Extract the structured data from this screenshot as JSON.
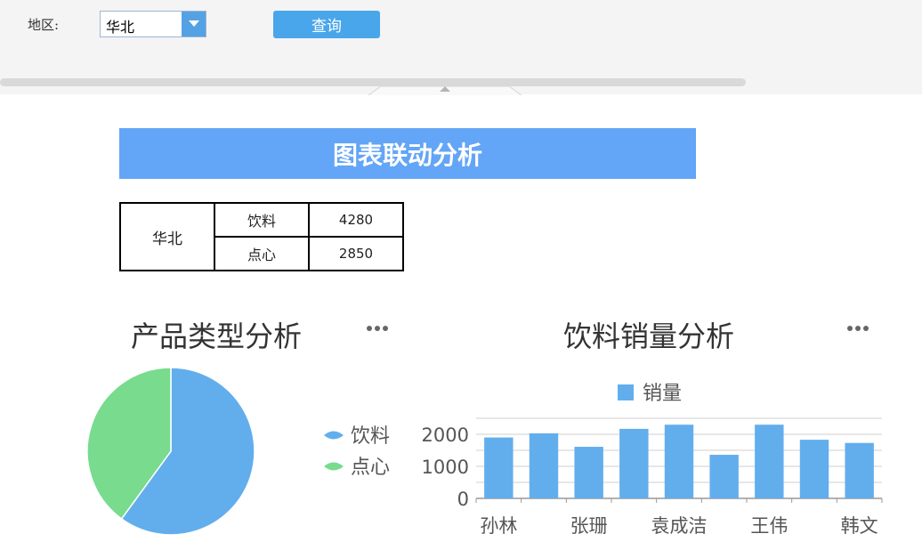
{
  "filter": {
    "region_label": "地区:",
    "region_value": "华北",
    "query_label": "查询"
  },
  "report": {
    "title": "图表联动分析",
    "table": {
      "region": "华北",
      "rows": [
        {
          "type": "饮料",
          "value": "4280"
        },
        {
          "type": "点心",
          "value": "2850"
        }
      ]
    }
  },
  "pie_chart": {
    "title": "产品类型分析",
    "more_icon": "ellipsis-icon"
  },
  "bar_chart": {
    "title": "饮料销量分析",
    "more_icon": "ellipsis-icon"
  },
  "colors": {
    "accent": "#4aa6ea",
    "title_bar": "#63a5f6",
    "series_blue": "#62aeed",
    "series_green": "#78db8e"
  },
  "chart_data": [
    {
      "type": "pie",
      "title": "产品类型分析",
      "legend": "right",
      "slices": [
        {
          "label": "饮料",
          "value": 4280,
          "color": "#62aeed"
        },
        {
          "label": "点心",
          "value": 2850,
          "color": "#78db8e"
        }
      ]
    },
    {
      "type": "bar",
      "title": "饮料销量分析",
      "legend": "top",
      "series": [
        {
          "name": "销量",
          "color": "#62aeed",
          "values": [
            1900,
            2030,
            1610,
            2170,
            2300,
            1360,
            2300,
            1830,
            1730
          ]
        }
      ],
      "categories": [
        "孙林",
        "",
        "张珊",
        "",
        "袁成洁",
        "",
        "王伟",
        "",
        "韩文"
      ],
      "yticks": [
        0,
        1000,
        2000
      ],
      "ylim": [
        0,
        2500
      ],
      "grid": true
    }
  ]
}
